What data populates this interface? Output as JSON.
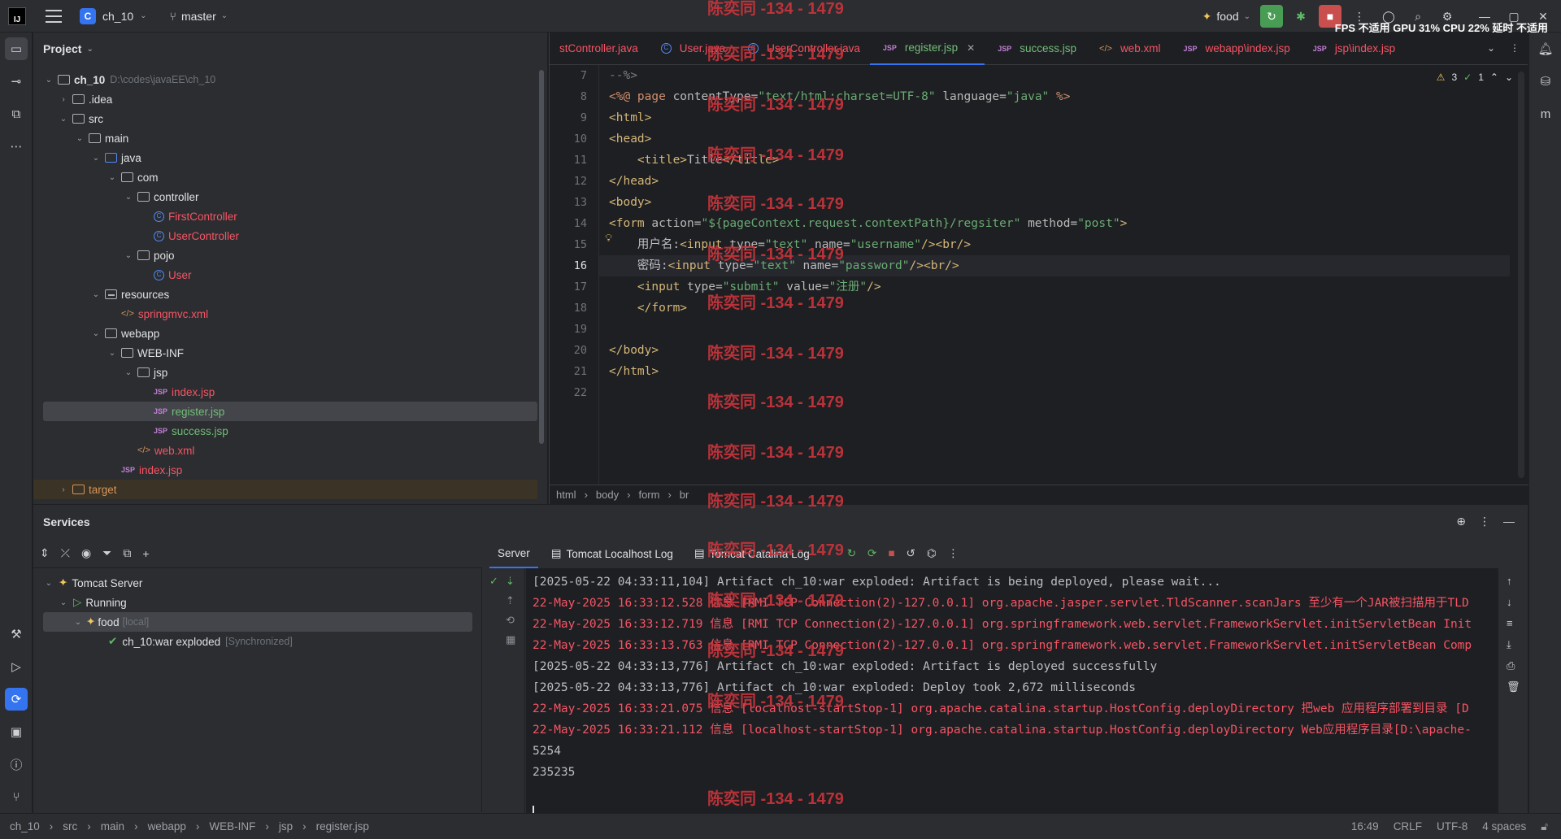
{
  "titlebar": {
    "logo": "IJ",
    "project_badge": "C",
    "project_name": "ch_10",
    "branch": "master",
    "run_config": "food",
    "stats": "FPS 不适用 GPU 31% CPU 22% 延时 不适用"
  },
  "project_panel": {
    "title": "Project",
    "root_name": "ch_10",
    "root_path": "D:\\codes\\javaEE\\ch_10",
    "items": [
      {
        "label": "ch_10"
      },
      {
        "label": ".idea"
      },
      {
        "label": "src"
      },
      {
        "label": "main"
      },
      {
        "label": "java"
      },
      {
        "label": "com"
      },
      {
        "label": "controller"
      },
      {
        "label": "FirstController"
      },
      {
        "label": "UserController"
      },
      {
        "label": "pojo"
      },
      {
        "label": "User"
      },
      {
        "label": "resources"
      },
      {
        "label": "springmvc.xml"
      },
      {
        "label": "webapp"
      },
      {
        "label": "WEB-INF"
      },
      {
        "label": "jsp"
      },
      {
        "label": "index.jsp"
      },
      {
        "label": "register.jsp"
      },
      {
        "label": "success.jsp"
      },
      {
        "label": "web.xml"
      },
      {
        "label": "index.jsp"
      },
      {
        "label": "target"
      }
    ]
  },
  "editor": {
    "tabs": [
      {
        "label": "stController.java"
      },
      {
        "label": "User.java"
      },
      {
        "label": "UserController.java"
      },
      {
        "label": "register.jsp"
      },
      {
        "label": "success.jsp"
      },
      {
        "label": "web.xml"
      },
      {
        "label": "webapp\\index.jsp"
      },
      {
        "label": "jsp\\index.jsp"
      }
    ],
    "inspections": {
      "warnings": "3",
      "ok": "1"
    },
    "line_numbers": [
      "7",
      "8",
      "9",
      "10",
      "11",
      "12",
      "13",
      "14",
      "15",
      "16",
      "17",
      "18",
      "19",
      "20",
      "21",
      "22"
    ],
    "code": {
      "l7": "--%>",
      "l8_a": "<%@ ",
      "l8_b": "page ",
      "l8_c": "contentType=",
      "l8_d": "\"text/html;charset=UTF-8\"",
      "l8_e": " language=",
      "l8_f": "\"java\"",
      "l8_g": " %>",
      "l9": "<html>",
      "l10": "<head>",
      "l11_a": "    <title>",
      "l11_b": "Title",
      "l11_c": "</title>",
      "l12": "</head>",
      "l13": "<body>",
      "l14_a": "<form ",
      "l14_b": "action=",
      "l14_c": "\"${pageContext.request.contextPath}/regsiter\"",
      "l14_d": " method=",
      "l14_e": "\"post\"",
      "l14_f": ">",
      "l15_a": "    用户名:",
      "l15_b": "<input ",
      "l15_c": "type=",
      "l15_d": "\"text\"",
      "l15_e": " name=",
      "l15_f": "\"username\"",
      "l15_g": "/><br/>",
      "l16_a": "    密码:",
      "l16_b": "<input ",
      "l16_c": "type=",
      "l16_d": "\"text\"",
      "l16_e": " name=",
      "l16_f": "\"password\"",
      "l16_g": "/><br/>",
      "l17_a": "    <input ",
      "l17_b": "type=",
      "l17_c": "\"submit\"",
      "l17_d": " value=",
      "l17_e": "\"注册\"",
      "l17_f": "/>",
      "l18": "    </form>",
      "l20": "</body>",
      "l21": "</html>"
    },
    "breadcrumb": [
      "html",
      "body",
      "form",
      "br"
    ]
  },
  "services": {
    "title": "Services",
    "tree": {
      "server": "Tomcat Server",
      "running": "Running",
      "config": "food",
      "config_tag": "[local]",
      "artifact": "ch_10:war exploded",
      "artifact_tag": "[Synchronized]"
    },
    "log_tabs": [
      "Server",
      "Tomcat Localhost Log",
      "Tomcat Catalina Log"
    ],
    "log_lines": [
      {
        "text": "[2025-05-22 04:33:11,104] Artifact ch_10:war exploded: Artifact is being deployed, please wait...",
        "kind": "plain"
      },
      {
        "text": "22-May-2025 16:33:12.528 信息 [RMI TCP Connection(2)-127.0.0.1] org.apache.jasper.servlet.TldScanner.scanJars 至少有一个JAR被扫描用于TLD",
        "kind": "err"
      },
      {
        "text": "22-May-2025 16:33:12.719 信息 [RMI TCP Connection(2)-127.0.0.1] org.springframework.web.servlet.FrameworkServlet.initServletBean Init",
        "kind": "err"
      },
      {
        "text": "22-May-2025 16:33:13.763 信息 [RMI TCP Connection(2)-127.0.0.1] org.springframework.web.servlet.FrameworkServlet.initServletBean Comp",
        "kind": "err"
      },
      {
        "text": "[2025-05-22 04:33:13,776] Artifact ch_10:war exploded: Artifact is deployed successfully",
        "kind": "plain"
      },
      {
        "text": "[2025-05-22 04:33:13,776] Artifact ch_10:war exploded: Deploy took 2,672 milliseconds",
        "kind": "plain"
      },
      {
        "text": "22-May-2025 16:33:21.075 信息 [localhost-startStop-1] org.apache.catalina.startup.HostConfig.deployDirectory 把web 应用程序部署到目录 [D",
        "kind": "err"
      },
      {
        "text": "22-May-2025 16:33:21.112 信息 [localhost-startStop-1] org.apache.catalina.startup.HostConfig.deployDirectory Web应用程序目录[D:\\apache-",
        "kind": "err"
      },
      {
        "text": "5254",
        "kind": "plain"
      },
      {
        "text": "235235",
        "kind": "plain"
      }
    ]
  },
  "statusbar": {
    "crumbs": [
      "ch_10",
      "src",
      "main",
      "webapp",
      "WEB-INF",
      "jsp",
      "register.jsp"
    ],
    "position": "16:49",
    "line_sep": "CRLF",
    "encoding": "UTF-8",
    "indent": "4 spaces"
  },
  "watermark": "陈奕同 -134 - 1479"
}
